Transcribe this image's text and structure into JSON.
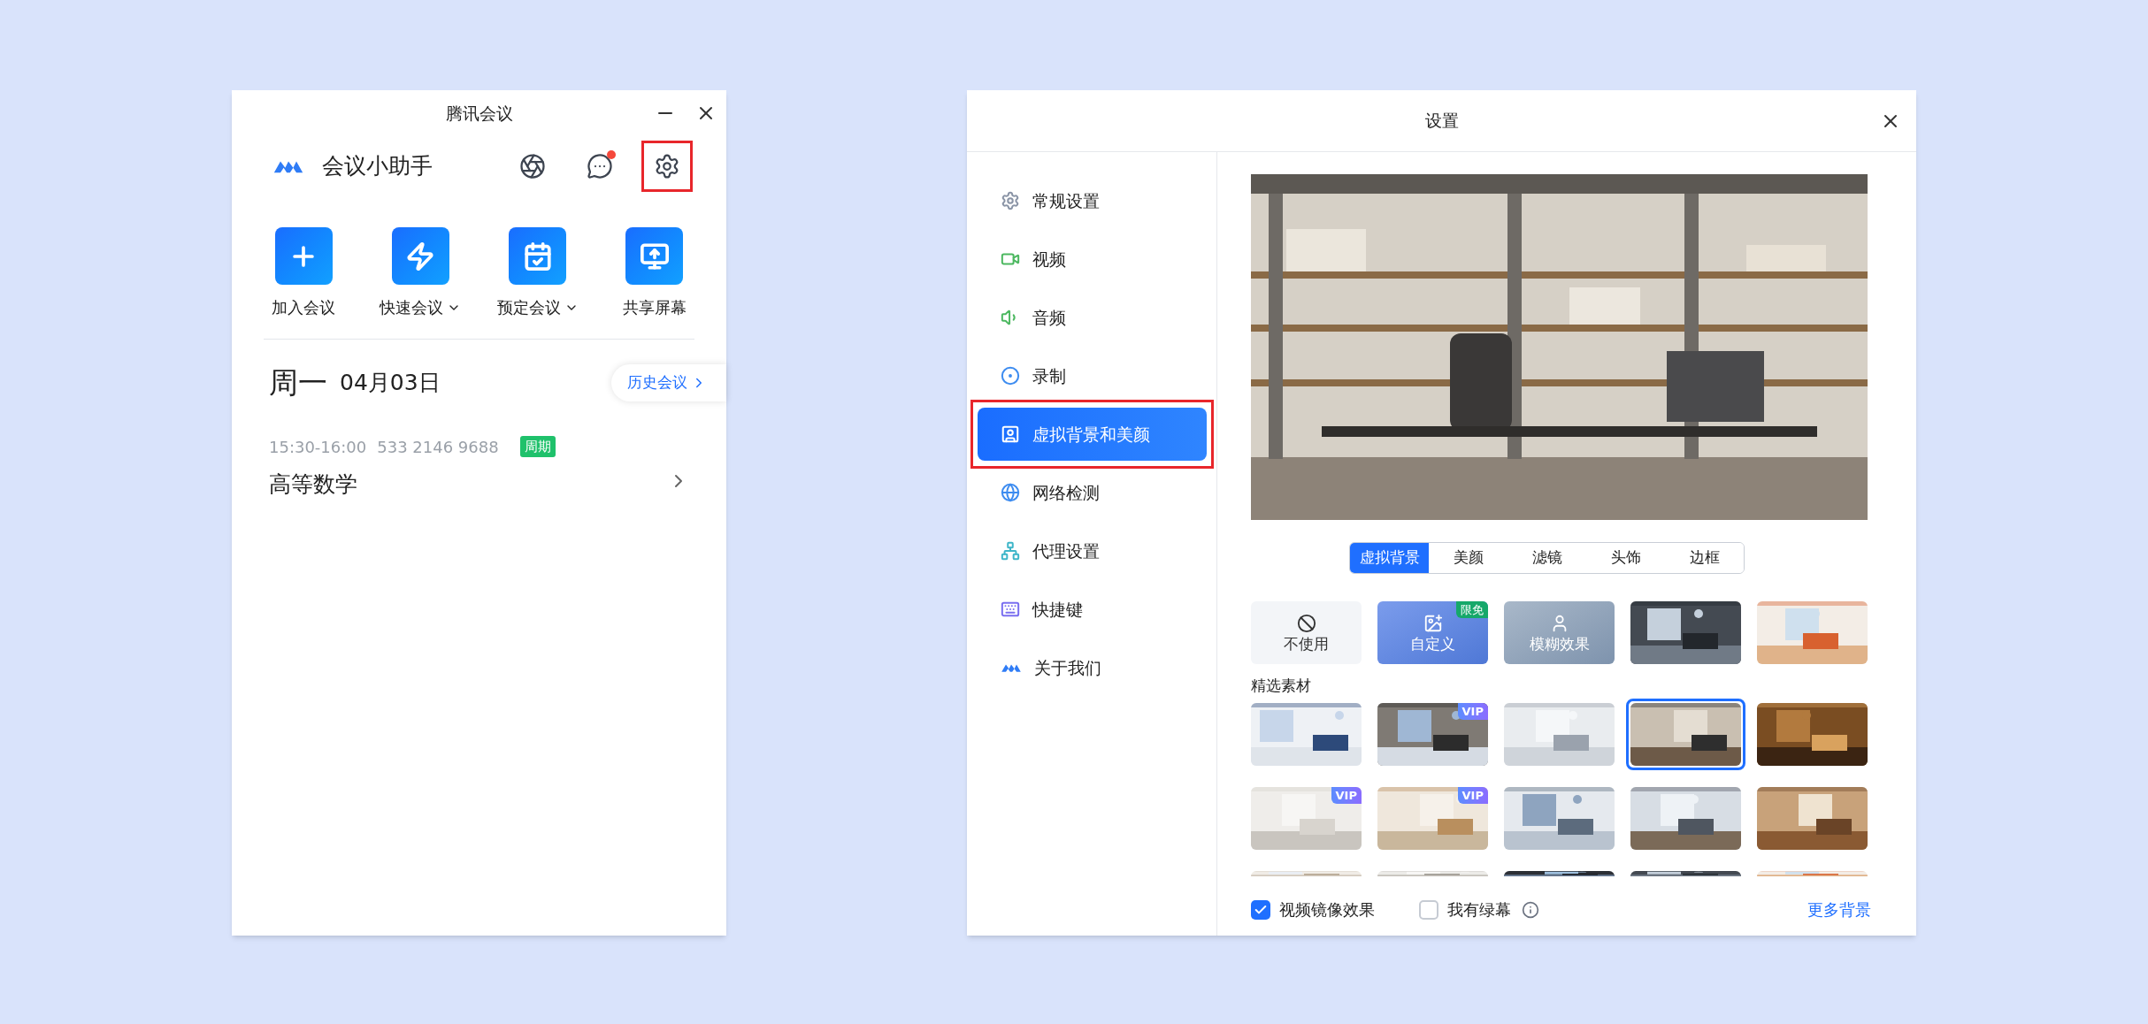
{
  "main_window": {
    "title": "腾讯会议",
    "header": {
      "title": "会议小助手",
      "buttons": [
        {
          "notification_dot": false,
          "highlighted": false
        },
        {
          "notification_dot": true,
          "highlighted": false
        },
        {
          "notification_dot": false,
          "highlighted": true
        }
      ]
    },
    "actions": [
      {
        "label": "加入会议",
        "has_menu": false
      },
      {
        "label": "快速会议",
        "has_menu": true
      },
      {
        "label": "预定会议",
        "has_menu": true
      },
      {
        "label": "共享屏幕",
        "has_menu": false
      }
    ],
    "date": {
      "weekday": "周一",
      "date": "04月03日"
    },
    "history_button": "历史会议",
    "meetings": [
      {
        "time": "15:30-16:00",
        "number": "533 2146 9688",
        "tag": "周期",
        "title": "高等数学"
      }
    ]
  },
  "settings_window": {
    "title": "设置",
    "sidebar": [
      {
        "label": "常规设置",
        "selected": false,
        "highlighted": false
      },
      {
        "label": "视频",
        "selected": false,
        "highlighted": false
      },
      {
        "label": "音频",
        "selected": false,
        "highlighted": false
      },
      {
        "label": "录制",
        "selected": false,
        "highlighted": false
      },
      {
        "label": "虚拟背景和美颜",
        "selected": true,
        "highlighted": true
      },
      {
        "label": "网络检测",
        "selected": false,
        "highlighted": false
      },
      {
        "label": "代理设置",
        "selected": false,
        "highlighted": false
      },
      {
        "label": "快捷键",
        "selected": false,
        "highlighted": false
      },
      {
        "label": "关于我们",
        "selected": false,
        "highlighted": false
      }
    ],
    "tabs": [
      {
        "label": "虚拟背景",
        "selected": true
      },
      {
        "label": "美颜",
        "selected": false
      },
      {
        "label": "滤镜",
        "selected": false
      },
      {
        "label": "头饰",
        "selected": false
      },
      {
        "label": "边框",
        "selected": false
      }
    ],
    "options": [
      {
        "kind": "none",
        "label": "不使用"
      },
      {
        "kind": "custom",
        "label": "自定义",
        "badge": "限免"
      },
      {
        "kind": "blur",
        "label": "模糊效果"
      },
      {
        "kind": "picture"
      },
      {
        "kind": "picture"
      }
    ],
    "section_title": "精选素材",
    "backgrounds": [
      {
        "kind": "full",
        "selected": false
      },
      {
        "kind": "full",
        "selected": false,
        "badge": "VIP"
      },
      {
        "kind": "full",
        "selected": false
      },
      {
        "kind": "full",
        "selected": true
      },
      {
        "kind": "full",
        "selected": false
      },
      {
        "kind": "full",
        "selected": false,
        "badge": "VIP"
      },
      {
        "kind": "full",
        "selected": false,
        "badge": "VIP"
      },
      {
        "kind": "full",
        "selected": false
      },
      {
        "kind": "full",
        "selected": false
      },
      {
        "kind": "full",
        "selected": false
      },
      {
        "kind": "partial",
        "selected": false
      },
      {
        "kind": "partial",
        "selected": false
      },
      {
        "kind": "partial",
        "selected": false
      },
      {
        "kind": "partial",
        "selected": false
      },
      {
        "kind": "partial",
        "selected": false
      }
    ],
    "mirror": {
      "label": "视频镜像效果",
      "checked": true
    },
    "green_screen": {
      "label": "我有绿幕",
      "checked": false
    },
    "more_link": "更多背景"
  }
}
